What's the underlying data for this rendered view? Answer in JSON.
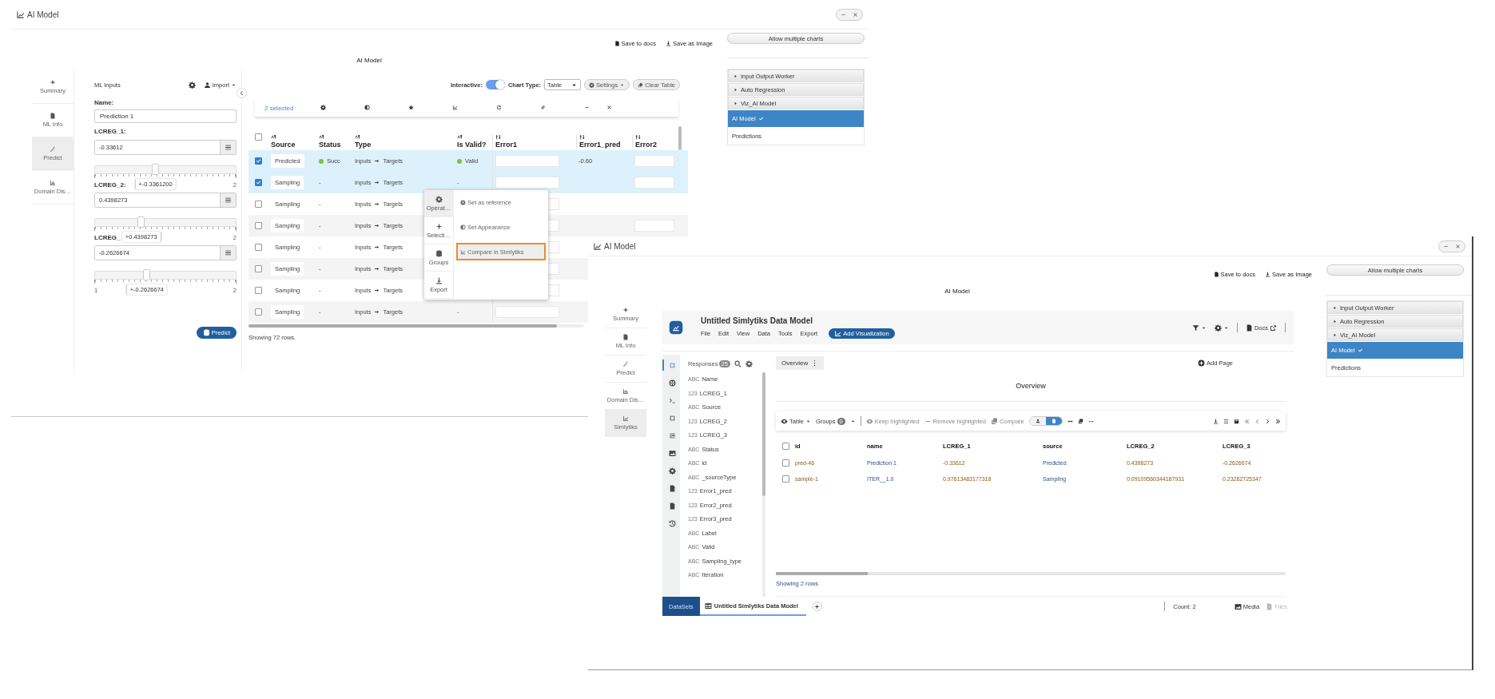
{
  "windows": [
    {
      "title": "AI Model",
      "actions": [
        "Save to docs",
        "Save as Image"
      ],
      "allow_button": "Allow multiple charts",
      "heading": "AI Model",
      "accordion": [
        {
          "label": "Input Output Worker",
          "kind": "group",
          "selected": false
        },
        {
          "label": "Auto Regression",
          "kind": "group",
          "selected": false
        },
        {
          "label": "Viz_AI Model",
          "kind": "group",
          "selected": false
        },
        {
          "label": "AI Model",
          "kind": "item",
          "selected": true
        },
        {
          "label": "Predictions",
          "kind": "item",
          "selected": false
        }
      ],
      "nav": [
        {
          "label": "Summary",
          "selected": false
        },
        {
          "label": "ML Info",
          "selected": false
        },
        {
          "label": "Predict",
          "selected": true
        },
        {
          "label": "Domain Dis…",
          "selected": false
        }
      ],
      "content": {
        "kind": "predict",
        "ml": {
          "title": "ML Inputs",
          "import": "Import",
          "name_label": "Name:",
          "name_value": "Prediction 1",
          "predict": "Predict",
          "params": [
            {
              "label": "LCREG_1:",
              "value": "-0.33612",
              "level": 0.43,
              "max": "2",
              "tip": "+-0.3361200"
            },
            {
              "label": "LCREG_2:",
              "value": "0.4398273",
              "level": 0.33,
              "max": "2",
              "tip": "+0.4398273"
            },
            {
              "label": "LCREG_",
              "value": "-0.2626674",
              "level": 0.37,
              "min": "1",
              "max": "2",
              "tip": "+-0.2626674"
            }
          ]
        },
        "table": {
          "interactive_label": "Interactive:",
          "interactive_on": true,
          "chart_type_label": "Chart Type:",
          "chart_type": "Table",
          "settings": "Settings",
          "clear": "Clear Table",
          "selection": "2 selected",
          "columns": [
            "Source",
            "Status",
            "Type",
            "Is Valid?",
            "Error1",
            "Error1_pred",
            "Error2"
          ],
          "all_selected": false,
          "rows": [
            {
              "selected": true,
              "source": "Predicted",
              "status": "Succ",
              "status_dot": {
                "color": "#7cc33f"
              },
              "from": "Inputs",
              "to": "Targets",
              "valid": "Valid",
              "valid_dot": {
                "color": "#7cc33f"
              },
              "error1_pred": "-0.60"
            },
            {
              "selected": true,
              "source": "Sampling",
              "status": "-",
              "from": "Inputs",
              "to": "Targets",
              "valid": "-"
            },
            {
              "selected": false,
              "source": "Sampling",
              "status": "-",
              "from": "Inputs",
              "to": "Targets"
            },
            {
              "selected": false,
              "source": "Sampling",
              "status": "-",
              "from": "Inputs",
              "to": "Targets"
            },
            {
              "selected": false,
              "source": "Sampling",
              "status": "-",
              "from": "Inputs",
              "to": "Targets"
            },
            {
              "selected": false,
              "source": "Sampling",
              "status": "-",
              "from": "Inputs",
              "to": "Targets"
            },
            {
              "selected": false,
              "source": "Sampling",
              "status": "-",
              "from": "Inputs",
              "to": "Targets"
            },
            {
              "selected": false,
              "source": "Sampling",
              "status": "-",
              "from": "Inputs",
              "to": "Targets",
              "valid": "-"
            }
          ],
          "footer": "Showing 72 rows."
        },
        "menu": {
          "tabs": [
            {
              "label": "Operat…",
              "selected": true
            },
            {
              "label": "Selecti…",
              "selected": false
            },
            {
              "label": "Groups",
              "selected": false
            },
            {
              "label": "Export",
              "selected": false
            }
          ],
          "options": [
            {
              "label": "Set as reference",
              "selected": false
            },
            {
              "label": "Set Appearance",
              "selected": false
            },
            {
              "label": "Compare in Simlytiks",
              "selected": true
            }
          ]
        }
      }
    },
    {
      "title": "AI Model",
      "actions": [
        "Save to docs",
        "Save as Image"
      ],
      "allow_button": "Allow multiple charts",
      "heading": "AI Model",
      "accordion": [
        {
          "label": "Input Output Worker",
          "kind": "group",
          "selected": false
        },
        {
          "label": "Auto Regression",
          "kind": "group",
          "selected": false
        },
        {
          "label": "Viz_AI Model",
          "kind": "group",
          "selected": false
        },
        {
          "label": "AI Model",
          "kind": "item",
          "selected": true
        },
        {
          "label": "Predictions",
          "kind": "item",
          "selected": false
        }
      ],
      "nav": [
        {
          "label": "Summary",
          "selected": false
        },
        {
          "label": "ML Info",
          "selected": false
        },
        {
          "label": "Predict",
          "selected": false
        },
        {
          "label": "Domain Dis…",
          "selected": false
        },
        {
          "label": "Simlytiks",
          "selected": true
        }
      ],
      "content": {
        "kind": "simlytiks",
        "title": "Untitled Simlytiks Data Model",
        "menu": [
          "File",
          "Edit",
          "View",
          "Data",
          "Tools",
          "Export"
        ],
        "add_button": "Add Visualization",
        "docs": "Docs",
        "rail": [
          {
            "selected": true
          },
          {
            "selected": false
          },
          {
            "selected": false
          },
          {
            "selected": false
          },
          {
            "selected": false
          },
          {
            "selected": false
          },
          {
            "selected": false
          },
          {
            "selected": false
          },
          {
            "selected": false
          },
          {
            "selected": false
          }
        ],
        "responses_label": "Responses",
        "responses_count": "25",
        "fields": [
          {
            "type": "ABC",
            "name": "Name"
          },
          {
            "type": "123",
            "name": "LCREG_1"
          },
          {
            "type": "ABC",
            "name": "Source"
          },
          {
            "type": "123",
            "name": "LCREG_2"
          },
          {
            "type": "123",
            "name": "LCREG_3"
          },
          {
            "type": "ABC",
            "name": "Status"
          },
          {
            "type": "ABC",
            "name": "id"
          },
          {
            "type": "ABC",
            "name": "_sourceType"
          },
          {
            "type": "123",
            "name": "Error1_pred"
          },
          {
            "type": "123",
            "name": "Error2_pred"
          },
          {
            "type": "123",
            "name": "Error3_pred"
          },
          {
            "type": "ABC",
            "name": "Label"
          },
          {
            "type": "ABC",
            "name": "Valid"
          },
          {
            "type": "ABC",
            "name": "Sampling_type"
          },
          {
            "type": "ABC",
            "name": "Iteration"
          }
        ],
        "page_tab": "Overview",
        "add_page": "Add Page",
        "page_title": "Overview",
        "toolbar": {
          "table": "Table",
          "groups": "Groups",
          "groups_count": "0",
          "keep": "Keep highlighted",
          "remove": "Remove highlighted",
          "compare": "Compare",
          "view_toggle": [
            {
              "selected": false
            },
            {
              "selected": true
            }
          ]
        },
        "columns": [
          "id",
          "name",
          "LCREG_1",
          "source",
          "LCREG_2",
          "LCREG_3"
        ],
        "all_selected": false,
        "rows": [
          {
            "selected": false,
            "cells": [
              "pred-46",
              "Prediction 1",
              "-0.33612",
              "Predicted",
              "0.4398273",
              "-0.2626674"
            ]
          },
          {
            "selected": false,
            "cells": [
              "sample-1",
              "ITER__1.0",
              "0.97613483177318",
              "Sampling",
              "0.09109560344187931",
              "0.23282725347"
            ]
          }
        ],
        "footer": "Showing 2 rows",
        "datasets": "DataSets",
        "tabs": [
          {
            "label": "Untitled Simlytiks Data Model",
            "selected": true
          }
        ],
        "count": "Count: 2",
        "media": "Media",
        "files": "Files",
        "files_disabled": true
      }
    }
  ]
}
